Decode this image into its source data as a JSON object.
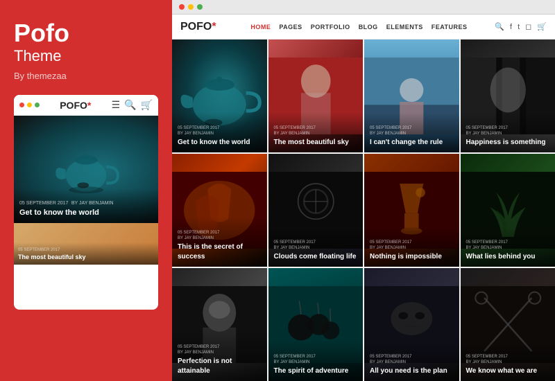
{
  "brand": {
    "name": "Pofo",
    "subtitle": "Theme",
    "by": "By themezaa"
  },
  "mobile": {
    "logo": "POFO",
    "logo_asterisk": "*",
    "hero_date": "05 SEPTEMBER 2017",
    "hero_author": "BY JAY BENJAMIN",
    "hero_title": "Get to know the world"
  },
  "browser": {
    "dots": [
      "red",
      "yellow",
      "green"
    ]
  },
  "site": {
    "logo": "POFO",
    "logo_asterisk": "*",
    "nav_links": [
      "HOME",
      "PAGES",
      "PORTFOLIO",
      "BLOG",
      "ELEMENTS",
      "FEATURES"
    ]
  },
  "grid": {
    "items": [
      {
        "date": "05 SEPTEMBER 2017",
        "author": "BY JAY BENJAMIN",
        "title": "Get to know the world",
        "bg": "teapot"
      },
      {
        "date": "05 SEPTEMBER 2017",
        "author": "BY JAY BENJAMIN",
        "title": "The most beautiful sky",
        "bg": "woman-red"
      },
      {
        "date": "05 SEPTEMBER 2017",
        "author": "BY JAY BENJAMIN",
        "title": "I can't change the rule",
        "bg": "blue-sky"
      },
      {
        "date": "05 SEPTEMBER 2017",
        "author": "BY JAY BENJAMIN",
        "title": "Happiness is something",
        "bg": "stripes"
      },
      {
        "date": "05 SEPTEMBER 2017",
        "author": "BY JAY BENJAMIN",
        "title": "This is the secret of success",
        "bg": "peppers"
      },
      {
        "date": "05 SEPTEMBER 2017",
        "author": "BY JAY BENJAMIN",
        "title": "Clouds come floating life",
        "bg": "dark-obj"
      },
      {
        "date": "05 SEPTEMBER 2017",
        "author": "BY JAY BENJAMIN",
        "title": "Nothing is impossible",
        "bg": "cocktail"
      },
      {
        "date": "05 SEPTEMBER 2017",
        "author": "BY JAY BENJAMIN",
        "title": "What lies behind you",
        "bg": "herbs"
      },
      {
        "date": "05 SEPTEMBER 2017",
        "author": "BY JAY BENJAMIN",
        "title": "Perfection is not attainable",
        "bg": "woman-bw"
      },
      {
        "date": "05 SEPTEMBER 2017",
        "author": "BY JAY BENJAMIN",
        "title": "The spirit of adventure",
        "bg": "balloons"
      },
      {
        "date": "05 SEPTEMBER 2017",
        "author": "BY JAY BENJAMIN",
        "title": "All you need is the plan",
        "bg": "mask"
      },
      {
        "date": "05 SEPTEMBER 2017",
        "author": "BY JAY BENJAMIN",
        "title": "We know what we are",
        "bg": "scissors"
      }
    ]
  }
}
